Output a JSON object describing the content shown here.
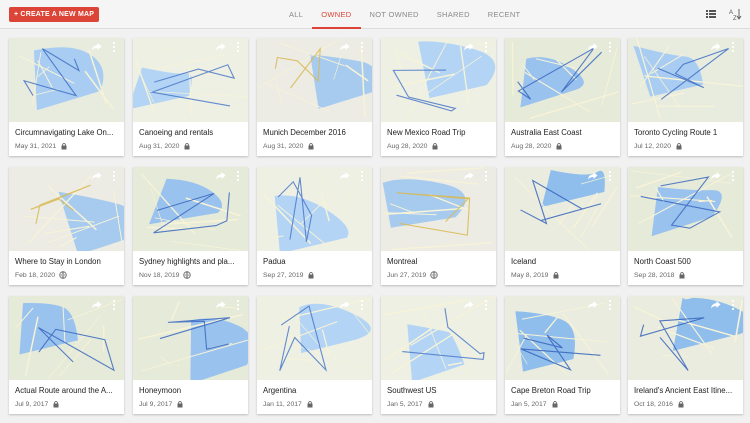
{
  "toolbar": {
    "create_label": "+ CREATE A NEW MAP",
    "tabs": [
      {
        "label": "ALL",
        "active": false
      },
      {
        "label": "OWNED",
        "active": true
      },
      {
        "label": "NOT OWNED",
        "active": false
      },
      {
        "label": "SHARED",
        "active": false
      },
      {
        "label": "RECENT",
        "active": false
      }
    ],
    "list_view_icon": "list-view-icon",
    "sort_icon": "sort-az-icon",
    "accent_color": "#db4437"
  },
  "maps": [
    {
      "title": "Circumnavigating Lake On...",
      "date": "May 31, 2021",
      "visibility": "private",
      "palette": "lake"
    },
    {
      "title": "Canoeing and rentals",
      "date": "Aug 31, 2020",
      "visibility": "private",
      "palette": "land"
    },
    {
      "title": "Munich December 2016",
      "date": "Aug 31, 2020",
      "visibility": "private",
      "palette": "city"
    },
    {
      "title": "New Mexico Road Trip",
      "date": "Aug 28, 2020",
      "visibility": "private",
      "palette": "land"
    },
    {
      "title": "Australia East Coast",
      "date": "Aug 28, 2020",
      "visibility": "private",
      "palette": "coast"
    },
    {
      "title": "Toronto Cycling Route 1",
      "date": "Jul 12, 2020",
      "visibility": "private",
      "palette": "lake"
    },
    {
      "title": "Where to Stay in London",
      "date": "Feb 18, 2020",
      "visibility": "public",
      "palette": "city"
    },
    {
      "title": "Sydney highlights and pla...",
      "date": "Nov 18, 2019",
      "visibility": "public",
      "palette": "coast"
    },
    {
      "title": "Padua",
      "date": "Sep 27, 2019",
      "visibility": "private",
      "palette": "land"
    },
    {
      "title": "Montreal",
      "date": "Jun 27, 2019",
      "visibility": "public",
      "palette": "city"
    },
    {
      "title": "Iceland",
      "date": "May 8, 2019",
      "visibility": "private",
      "palette": "island"
    },
    {
      "title": "North Coast 500",
      "date": "Sep 28, 2018",
      "visibility": "private",
      "palette": "coast"
    },
    {
      "title": "Actual Route around the A...",
      "date": "Jul 9, 2017",
      "visibility": "private",
      "palette": "coast"
    },
    {
      "title": "Honeymoon",
      "date": "Jul 9, 2017",
      "visibility": "private",
      "palette": "coast"
    },
    {
      "title": "Argentina",
      "date": "Jan 11, 2017",
      "visibility": "private",
      "palette": "land"
    },
    {
      "title": "Southwest US",
      "date": "Jan 5, 2017",
      "visibility": "private",
      "palette": "land"
    },
    {
      "title": "Cape Breton Road Trip",
      "date": "Jan 5, 2017",
      "visibility": "private",
      "palette": "island"
    },
    {
      "title": "Ireland's Ancient East Itine...",
      "date": "Oct 18, 2016",
      "visibility": "private",
      "palette": "island"
    }
  ]
}
